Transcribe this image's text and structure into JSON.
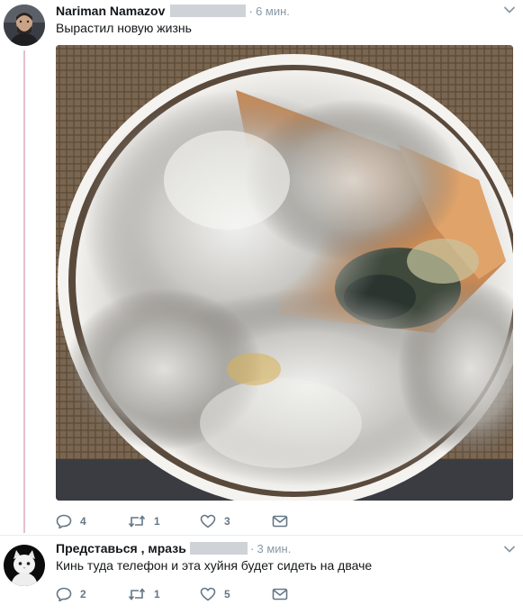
{
  "tweets": [
    {
      "author": "Nariman Namazov",
      "separator": "·",
      "time": "6 мин.",
      "text": "Вырастил новую жизнь",
      "media": "mold-bowl-photo",
      "actions": {
        "reply_count": "4",
        "retweet_count": "1",
        "like_count": "3"
      }
    },
    {
      "author": "Представься , мразь",
      "separator": "·",
      "time": "3 мин.",
      "text": "Кинь туда телефон и эта хуйня будет сидеть на дваче",
      "actions": {
        "reply_count": "2",
        "retweet_count": "1",
        "like_count": "5"
      }
    }
  ],
  "colors": {
    "name": "#14171a",
    "muted": "#8899a6",
    "action": "#657786",
    "thread_line": "#e6bfca",
    "redaction": "#cfd2d6"
  },
  "icons": [
    "reply-icon",
    "retweet-icon",
    "like-icon",
    "direct-message-icon",
    "caret-down-icon"
  ]
}
